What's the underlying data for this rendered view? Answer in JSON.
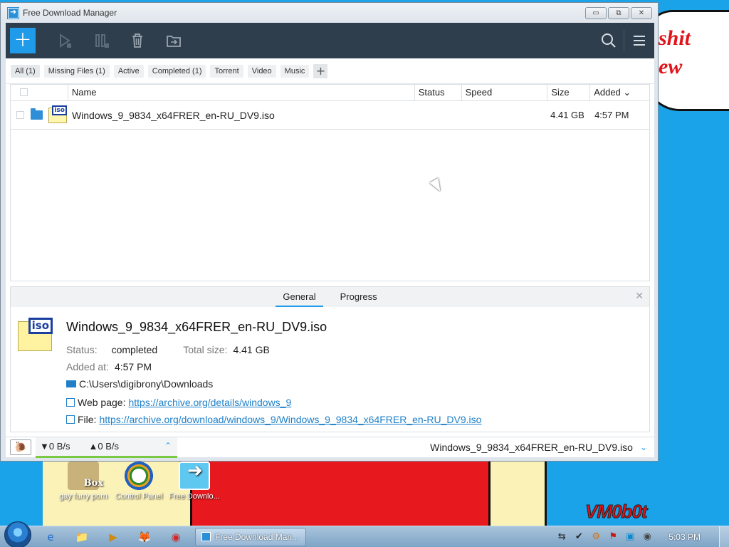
{
  "window": {
    "title": "Free Download Manager",
    "controls": {
      "minimize": "▭",
      "maximize": "⧉",
      "close": "✕"
    }
  },
  "toolbar": {
    "add_symbol": "+",
    "icons": [
      "add-icon",
      "resume-icon",
      "pause-icon",
      "delete-icon",
      "move-icon",
      "search-icon",
      "menu-icon"
    ]
  },
  "filters": [
    "All (1)",
    "Missing Files (1)",
    "Active",
    "Completed (1)",
    "Torrent",
    "Video",
    "Music"
  ],
  "filter_add": "+",
  "table": {
    "columns": {
      "name": "Name",
      "status": "Status",
      "speed": "Speed",
      "size": "Size",
      "added": "Added ⌄"
    },
    "rows": [
      {
        "name": "Windows_9_9834_x64FRER_en-RU_DV9.iso",
        "status": "",
        "speed": "",
        "size": "4.41 GB",
        "added": "4:57 PM"
      }
    ]
  },
  "details": {
    "tabs": [
      "General",
      "Progress"
    ],
    "close": "✕",
    "iso_tag": "iso",
    "file_name": "Windows_9_9834_x64FRER_en-RU_DV9.iso",
    "status_label": "Status:",
    "status_value": "completed",
    "total_size_label": "Total size:",
    "total_size_value": "4.41 GB",
    "added_label": "Added at:",
    "added_value": "4:57 PM",
    "path": "C:\\Users\\digibrony\\Downloads",
    "web_page_label": "Web page:",
    "web_page_url": "https://archive.org/details/windows_9",
    "file_label": "File:",
    "file_url": "https://archive.org/download/windows_9/Windows_9_9834_x64FRER_en-RU_DV9.iso"
  },
  "statusbar": {
    "snail": "🐌",
    "down_speed": "▼0 B/s",
    "up_speed": "▲0 B/s",
    "caret": "⌃",
    "current_file": "Windows_9_9834_x64FRER_en-RU_DV9.iso",
    "chevron": "⌄"
  },
  "desktop": {
    "icons": [
      {
        "label": "gay furry porn"
      },
      {
        "label": "Control Panel"
      },
      {
        "label": "Free Downlo..."
      }
    ],
    "bubble_text": "shit\new",
    "signature": "VM0b0t"
  },
  "taskbar": {
    "quick_launch": [
      "e",
      "📁",
      "▶",
      "🦊",
      "◉"
    ],
    "task_label": "Free Download Man...",
    "tray": [
      "⇆",
      "✔",
      "⚙",
      "⚑",
      "▣",
      "◉"
    ],
    "clock": "5:03 PM"
  }
}
